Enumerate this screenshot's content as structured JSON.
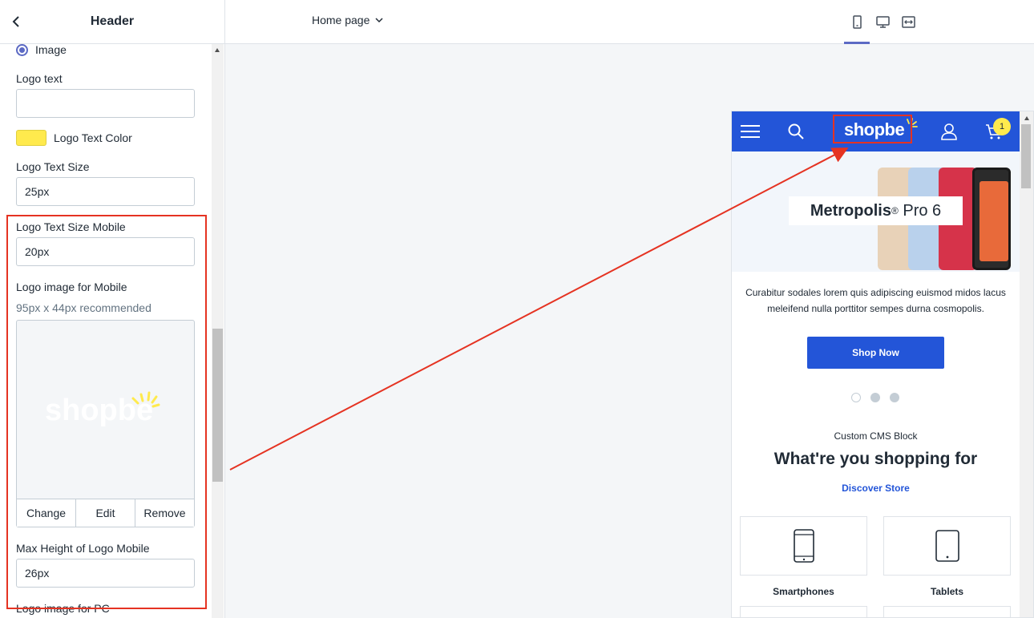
{
  "sidebar": {
    "title": "Header",
    "image_radio_label": "Image",
    "logo_text_label": "Logo text",
    "logo_text_value": "",
    "logo_text_color_label": "Logo Text Color",
    "logo_text_color": "#ffea4d",
    "logo_text_size_label": "Logo Text Size",
    "logo_text_size_value": "25px",
    "logo_text_size_mobile_label": "Logo Text Size Mobile",
    "logo_text_size_mobile_value": "20px",
    "logo_image_mobile_label": "Logo image for Mobile",
    "logo_image_mobile_hint": "95px x 44px recommended",
    "logo_image_preview_text": "shopbe",
    "image_actions": {
      "change": "Change",
      "edit": "Edit",
      "remove": "Remove"
    },
    "max_height_mobile_label": "Max Height of Logo Mobile",
    "max_height_mobile_value": "26px",
    "logo_image_pc_label": "Logo image for PC"
  },
  "topbar": {
    "page_select": "Home page",
    "devices": [
      "mobile-icon",
      "desktop-icon",
      "fullwidth-icon"
    ],
    "active_device": "mobile"
  },
  "preview": {
    "logo_text": "shopbe",
    "cart_count": "1",
    "banner_title_bold": "Metropolis",
    "banner_title_sup": "®",
    "banner_title_rest": " Pro 6",
    "description": "Curabitur sodales lorem quis adipiscing euismod midos lacus meleifend nulla porttitor sempes durna cosmopolis.",
    "shop_button": "Shop Now",
    "cms_subtitle": "Custom CMS Block",
    "cms_title": "What're you shopping for",
    "discover_link": "Discover Store",
    "categories": [
      "Smartphones",
      "Tablets"
    ]
  },
  "colors": {
    "accent": "#5c6ac4",
    "brand_blue": "#2355d8",
    "highlight_red": "#e53322",
    "logo_yellow": "#ffea4d"
  }
}
